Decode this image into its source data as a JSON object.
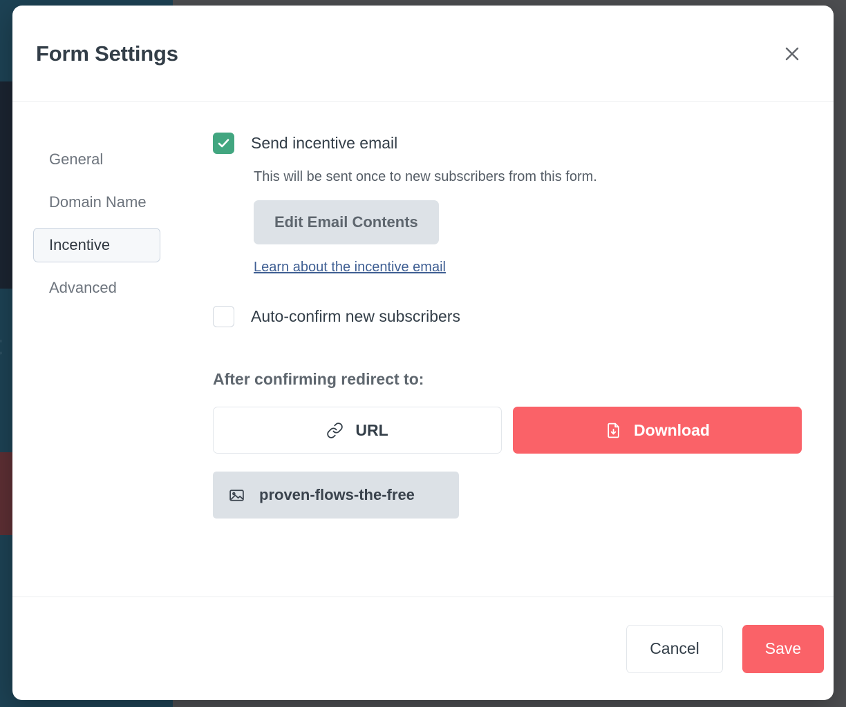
{
  "modal": {
    "title": "Form Settings",
    "close_icon": "close-icon"
  },
  "tabs": [
    {
      "label": "General",
      "active": false
    },
    {
      "label": "Domain Name",
      "active": false
    },
    {
      "label": "Incentive",
      "active": true
    },
    {
      "label": "Advanced",
      "active": false
    }
  ],
  "incentive": {
    "send_email": {
      "label": "Send incentive email",
      "checked": true,
      "checkmark": "✔"
    },
    "help_text": "This will be sent once to new subscribers from this form.",
    "edit_email_button": "Edit Email Contents",
    "help_link": "Learn about the incentive email",
    "auto_confirm": {
      "label": "Auto-confirm new subscribers",
      "checked": false
    },
    "redirect_heading": "After confirming redirect to:",
    "redirect_options": [
      {
        "label": "URL",
        "icon": "link-icon",
        "active": false
      },
      {
        "label": "Download",
        "icon": "download-file-icon",
        "active": true
      }
    ],
    "file_chip": {
      "name": "proven-flows-the-free",
      "icon": "image-file-icon"
    }
  },
  "footer": {
    "cancel_label": "Cancel",
    "save_label": "Save"
  },
  "colors": {
    "accent_red": "#fa6268",
    "checkbox_green": "#42a680",
    "link_blue": "#3f5f93",
    "muted_button": "#dde2e7",
    "backdrop_sidebar": "#1d4254",
    "backdrop": "#4d4e51"
  }
}
